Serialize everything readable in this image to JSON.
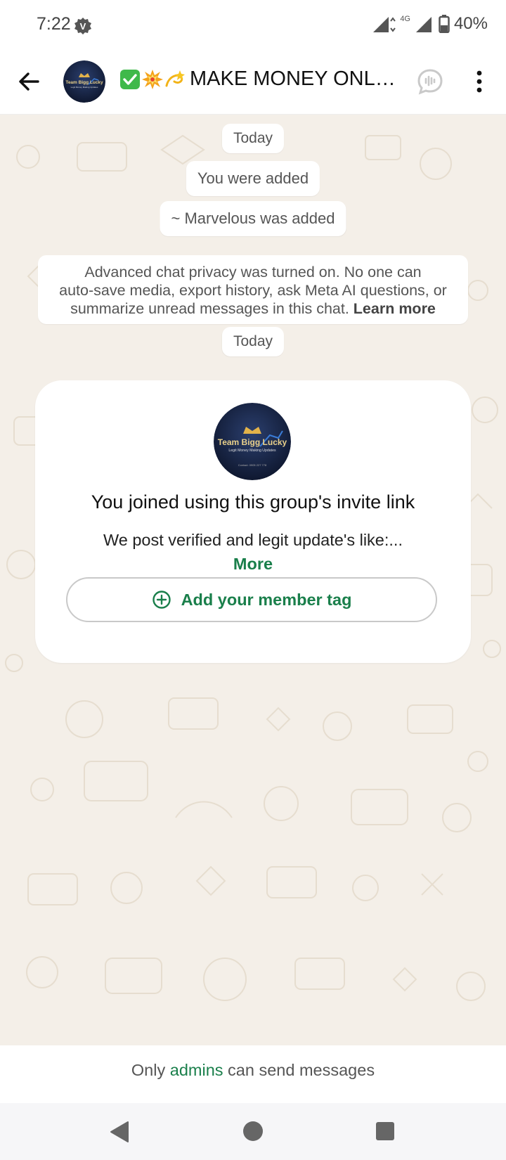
{
  "status_bar": {
    "time": "7:22",
    "network": "4G",
    "battery": "40%"
  },
  "header": {
    "title": "MAKE MONEY ONLIN…",
    "title_emojis": [
      "check-mark-button",
      "collision",
      "dizzy"
    ],
    "avatar_text": [
      "Team Bigg Lucky",
      "Legit Money Making Updates"
    ]
  },
  "chat": {
    "date_pill_1": "Today",
    "system_1": "You were added",
    "system_2": "~ Marvelous was added",
    "privacy_notice": {
      "line1": "Advanced chat privacy was turned on. No one can",
      "line2": "auto-save media, export history, ask Meta AI questions, or",
      "line3": "summarize unread messages in this chat.",
      "link": "Learn more"
    },
    "date_pill_2": "Today",
    "invite_card": {
      "title": "You joined using this group's invite link",
      "description": "We post verified and legit update's like:...",
      "more_label": "More",
      "tag_button_label": "Add your member tag",
      "avatar_text": [
        "Team Bigg Lucky",
        "Legit Money Making Updates",
        "Contact: 0905 227 778"
      ]
    }
  },
  "footer": {
    "prefix": "Only ",
    "admins_link": "admins",
    "suffix": " can send messages"
  },
  "colors": {
    "accent_green": "#1a7f4b",
    "wallpaper": "#f4efe8"
  }
}
